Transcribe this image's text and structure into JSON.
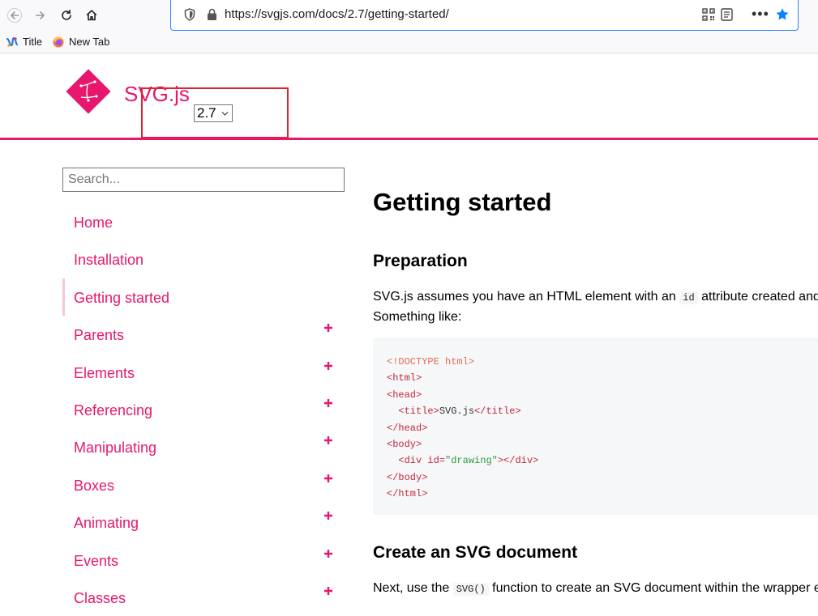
{
  "browser": {
    "url": "https://svgjs.com/docs/2.7/getting-started/",
    "bookmarks": [
      {
        "label": "Title"
      },
      {
        "label": "New Tab"
      }
    ],
    "more_label": "•••"
  },
  "site": {
    "brand": "SVG.js",
    "version": "2.7",
    "brand_color": "#e6176c"
  },
  "sidebar": {
    "search_placeholder": "Search...",
    "items": [
      {
        "label": "Home",
        "expandable": false
      },
      {
        "label": "Installation",
        "expandable": false
      },
      {
        "label": "Getting started",
        "expandable": false,
        "active": true
      },
      {
        "label": "Parents",
        "expandable": true
      },
      {
        "label": "Elements",
        "expandable": true
      },
      {
        "label": "Referencing",
        "expandable": true
      },
      {
        "label": "Manipulating",
        "expandable": true
      },
      {
        "label": "Boxes",
        "expandable": true
      },
      {
        "label": "Animating",
        "expandable": true
      },
      {
        "label": "Events",
        "expandable": true
      },
      {
        "label": "Classes",
        "expandable": true
      }
    ],
    "expand_glyph": "+"
  },
  "main": {
    "title": "Getting started",
    "sections": [
      {
        "heading": "Preparation",
        "para_line1_pre": "SVG.js assumes you have an HTML element with an ",
        "para_line1_code": "id",
        "para_line1_post": " attribute created and",
        "para_line2": "Something like:"
      },
      {
        "heading": "Create an SVG document",
        "para_pre": "Next, use the ",
        "para_code": "SVG()",
        "para_post": " function to create an SVG document within the wrapper e"
      }
    ],
    "code": {
      "doctype": "<!DOCTYPE html>",
      "html_open": "<html>",
      "head_open": "<head>",
      "title_open": "<title>",
      "title_text": "SVG.js",
      "title_close": "</title>",
      "head_close": "</head>",
      "body_open": "<body>",
      "div_open_pre": "<div ",
      "div_attr": "id=",
      "div_value": "\"drawing\"",
      "div_open_post": ">",
      "div_close": "</div>",
      "body_close": "</body>",
      "html_close": "</html>"
    }
  }
}
